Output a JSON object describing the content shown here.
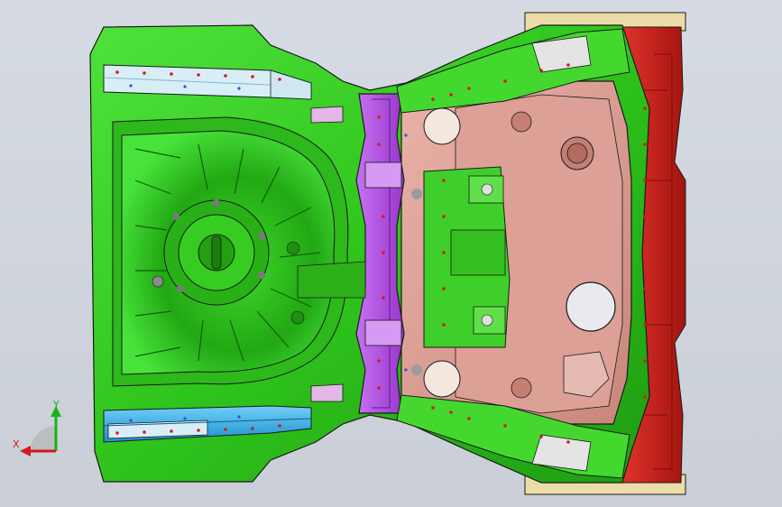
{
  "window": {
    "type": "CAD graphics viewport",
    "background_color": "#cdd2da"
  },
  "model": {
    "description_icon": "car-rear-floor-assembly-model",
    "colors": {
      "floor_green": "#32c81e",
      "floor_green_dark": "#1f8f12",
      "crossmember_purple": "#b14fe0",
      "tunnel_pink": "#d99a8f",
      "side_red": "#c61c18",
      "rail_blue": "#2aa7e6",
      "rail_light": "#d8eef7",
      "bracket_tan": "#e8d7a6",
      "edge_black": "#1a1a1a"
    }
  },
  "triad": {
    "x_label": "X",
    "y_label": "Y",
    "x_color": "#d8181a",
    "y_color": "#18b21a",
    "z_color": "#9a9a9a"
  }
}
